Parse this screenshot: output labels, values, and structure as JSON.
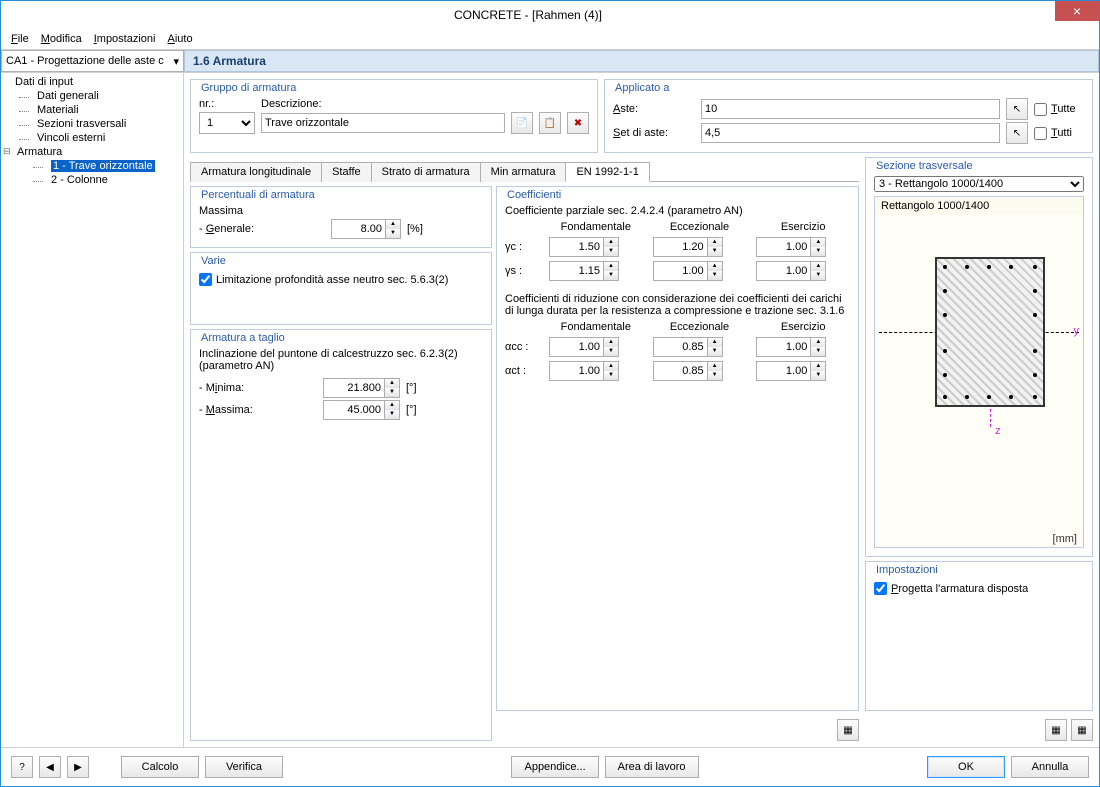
{
  "window": {
    "title": "CONCRETE - [Rahmen (4)]"
  },
  "menu": {
    "file": "File",
    "modifica": "Modifica",
    "impostazioni": "Impostazioni",
    "aiuto": "Aiuto"
  },
  "module_dropdown": "CA1 - Progettazione delle aste c",
  "section_title": "1.6 Armatura",
  "tree": {
    "root": "Dati di input",
    "items": [
      "Dati generali",
      "Materiali",
      "Sezioni trasversali",
      "Vincoli esterni"
    ],
    "armatura": "Armatura",
    "arm_sub": [
      "1 - Trave orizzontale",
      "2 - Colonne"
    ]
  },
  "gruppo": {
    "legend": "Gruppo di armatura",
    "nr_label": "nr.:",
    "nr_value": "1",
    "desc_label": "Descrizione:",
    "desc_value": "Trave orizzontale"
  },
  "applicato": {
    "legend": "Applicato a",
    "aste_label": "Aste:",
    "aste_value": "10",
    "set_label": "Set di aste:",
    "set_value": "4,5",
    "tutte": "Tutte",
    "tutti": "Tutti"
  },
  "tabs": [
    "Armatura longitudinale",
    "Staffe",
    "Strato di armatura",
    "Min armatura",
    "EN 1992-1-1"
  ],
  "percentuali": {
    "legend": "Percentuali di armatura",
    "massima": "Massima",
    "generale": "- Generale:",
    "generale_val": "8.00",
    "unit": "[%]"
  },
  "varie": {
    "legend": "Varie",
    "limitazione": "Limitazione profondità asse neutro sec. 5.6.3(2)"
  },
  "taglio": {
    "legend": "Armatura a taglio",
    "desc": "Inclinazione del puntone di calcestruzzo sec. 6.2.3(2) (parametro AN)",
    "minima_label": "- Minima:",
    "minima_val": "21.800",
    "massima_label": "- Massima:",
    "massima_val": "45.000",
    "unit": "[°]"
  },
  "coeff": {
    "legend": "Coefficienti",
    "parziale": "Coefficiente parziale sec. 2.4.2.4 (parametro AN)",
    "headers": [
      "Fondamentale",
      "Eccezionale",
      "Esercizio"
    ],
    "gc": "γc :",
    "gc_vals": [
      "1.50",
      "1.20",
      "1.00"
    ],
    "gs": "γs :",
    "gs_vals": [
      "1.15",
      "1.00",
      "1.00"
    ],
    "riduzione": "Coefficienti di riduzione con considerazione dei coefficienti dei carichi di lunga durata per la resistenza a compressione e trazione sec. 3.1.6",
    "acc": "αcc :",
    "acc_vals": [
      "1.00",
      "0.85",
      "1.00"
    ],
    "act": "αct :",
    "act_vals": [
      "1.00",
      "0.85",
      "1.00"
    ]
  },
  "sezione": {
    "legend": "Sezione trasversale",
    "select": "3 - Rettangolo 1000/1400",
    "title": "Rettangolo 1000/1400",
    "unit": "[mm]",
    "y": "y",
    "z": "z"
  },
  "impostazioni": {
    "legend": "Impostazioni",
    "progetta": "Progetta l'armatura disposta"
  },
  "buttons": {
    "calcolo": "Calcolo",
    "verifica": "Verifica",
    "appendice": "Appendice...",
    "area": "Area di lavoro",
    "ok": "OK",
    "annulla": "Annulla"
  }
}
